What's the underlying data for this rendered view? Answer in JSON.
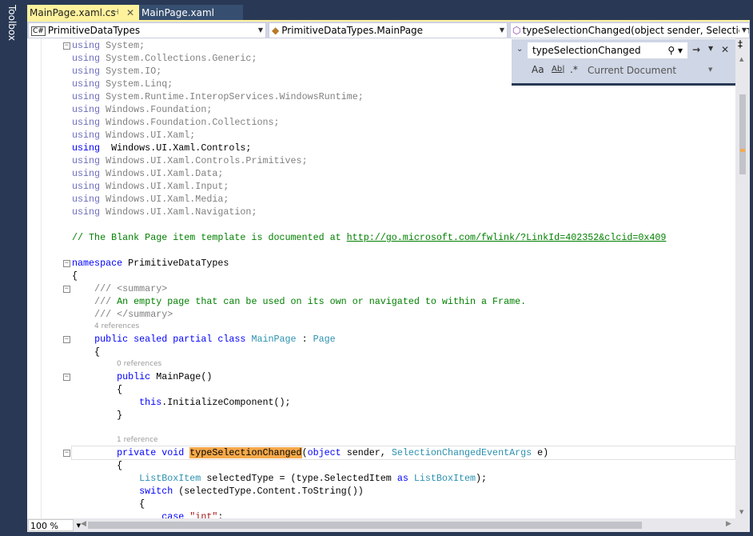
{
  "toolbox": "Toolbox",
  "tabs": [
    {
      "label": "MainPage.xaml.cs",
      "active": true
    },
    {
      "label": "MainPage.xaml",
      "active": false
    }
  ],
  "nav": {
    "project": "PrimitiveDataTypes",
    "class": "PrimitiveDataTypes.MainPage",
    "member": "typeSelectionChanged(object sender, SelectionCh"
  },
  "find": {
    "query": "typeSelectionChanged",
    "scope": "Current Document",
    "match_case": "Aa",
    "whole_word": "Ab|",
    "regex": ".*"
  },
  "zoom": "100 %",
  "colors": {
    "accent_tab": "#fff29d",
    "frame": "#293955",
    "highlight": "#f5a94b"
  },
  "lines": [
    {
      "f": 1,
      "s": [
        [
          "kwg",
          "using"
        ],
        [
          "gr",
          " System;"
        ]
      ]
    },
    {
      "s": [
        [
          "kwg",
          "using"
        ],
        [
          "gr",
          " System.Collections.Generic;"
        ]
      ]
    },
    {
      "s": [
        [
          "kwg",
          "using"
        ],
        [
          "gr",
          " System.IO;"
        ]
      ]
    },
    {
      "s": [
        [
          "kwg",
          "using"
        ],
        [
          "gr",
          " System.Linq;"
        ]
      ]
    },
    {
      "s": [
        [
          "kwg",
          "using"
        ],
        [
          "gr",
          " System.Runtime.InteropServices.WindowsRuntime;"
        ]
      ]
    },
    {
      "s": [
        [
          "kwg",
          "using"
        ],
        [
          "gr",
          " Windows.Foundation;"
        ]
      ]
    },
    {
      "s": [
        [
          "kwg",
          "using"
        ],
        [
          "gr",
          " Windows.Foundation.Collections;"
        ]
      ]
    },
    {
      "s": [
        [
          "kwg",
          "using"
        ],
        [
          "gr",
          " Windows.UI.Xaml;"
        ]
      ]
    },
    {
      "s": [
        [
          "kw",
          "using"
        ],
        [
          "",
          ""
        ],
        [
          "",
          "  Windows.UI.Xaml.Controls;"
        ]
      ]
    },
    {
      "s": [
        [
          "kwg",
          "using"
        ],
        [
          "gr",
          " Windows.UI.Xaml.Controls.Primitives;"
        ]
      ]
    },
    {
      "s": [
        [
          "kwg",
          "using"
        ],
        [
          "gr",
          " Windows.UI.Xaml.Data;"
        ]
      ]
    },
    {
      "s": [
        [
          "kwg",
          "using"
        ],
        [
          "gr",
          " Windows.UI.Xaml.Input;"
        ]
      ]
    },
    {
      "s": [
        [
          "kwg",
          "using"
        ],
        [
          "gr",
          " Windows.UI.Xaml.Media;"
        ]
      ]
    },
    {
      "s": [
        [
          "kwg",
          "using"
        ],
        [
          "gr",
          " Windows.UI.Xaml.Navigation;"
        ]
      ]
    },
    {
      "s": []
    },
    {
      "s": [
        [
          "cm",
          "// The Blank Page item template is documented at "
        ],
        [
          "url",
          "http://go.microsoft.com/fwlink/?LinkId=402352&clcid=0x409"
        ]
      ]
    },
    {
      "s": []
    },
    {
      "f": 1,
      "s": [
        [
          "kw",
          "namespace"
        ],
        [
          "",
          " PrimitiveDataTypes"
        ]
      ]
    },
    {
      "s": [
        [
          "",
          "{"
        ]
      ]
    },
    {
      "f": 1,
      "s": [
        [
          "gr",
          "    /// <summary>"
        ]
      ]
    },
    {
      "s": [
        [
          "gr",
          "    ///"
        ],
        [
          "cm",
          " An empty page that can be used on its own or navigated to within a Frame."
        ]
      ]
    },
    {
      "s": [
        [
          "gr",
          "    /// </summary>"
        ]
      ]
    },
    {
      "lens": "4 references",
      "ind": 4
    },
    {
      "f": 1,
      "s": [
        [
          "",
          "    "
        ],
        [
          "kw",
          "public sealed partial class"
        ],
        [
          "",
          " "
        ],
        [
          "ty",
          "MainPage"
        ],
        [
          "",
          " : "
        ],
        [
          "ty",
          "Page"
        ]
      ]
    },
    {
      "s": [
        [
          "",
          "    {"
        ]
      ]
    },
    {
      "lens": "0 references",
      "ind": 8
    },
    {
      "f": 1,
      "s": [
        [
          "",
          "        "
        ],
        [
          "kw",
          "public"
        ],
        [
          "",
          " MainPage()"
        ]
      ]
    },
    {
      "s": [
        [
          "",
          "        {"
        ]
      ]
    },
    {
      "s": [
        [
          "",
          "            "
        ],
        [
          "kw",
          "this"
        ],
        [
          "",
          ".InitializeComponent();"
        ]
      ]
    },
    {
      "s": [
        [
          "",
          "        }"
        ]
      ]
    },
    {
      "s": []
    },
    {
      "lens": "1 reference",
      "ind": 8
    },
    {
      "f": 1,
      "cur": 1,
      "s": [
        [
          "",
          "        "
        ],
        [
          "kw",
          "private void"
        ],
        [
          "",
          " "
        ],
        [
          "hl",
          "typeSelectionChanged"
        ],
        [
          "",
          "("
        ],
        [
          "kw",
          "object"
        ],
        [
          "",
          " sender, "
        ],
        [
          "ty",
          "SelectionChangedEventArgs"
        ],
        [
          "",
          " e)"
        ]
      ]
    },
    {
      "s": [
        [
          "",
          "        {"
        ]
      ]
    },
    {
      "s": [
        [
          "",
          "            "
        ],
        [
          "ty",
          "ListBoxItem"
        ],
        [
          "",
          " selectedType = (type.SelectedItem "
        ],
        [
          "kw",
          "as"
        ],
        [
          "",
          " "
        ],
        [
          "ty",
          "ListBoxItem"
        ],
        [
          "",
          ");"
        ]
      ]
    },
    {
      "s": [
        [
          "",
          "            "
        ],
        [
          "kw",
          "switch"
        ],
        [
          "",
          " (selectedType.Content.ToString())"
        ]
      ]
    },
    {
      "s": [
        [
          "",
          "            {"
        ]
      ]
    },
    {
      "s": [
        [
          "",
          "                "
        ],
        [
          "kw",
          "case"
        ],
        [
          "",
          " "
        ],
        [
          "st",
          "\"int\""
        ],
        [
          "",
          ":"
        ]
      ]
    }
  ]
}
